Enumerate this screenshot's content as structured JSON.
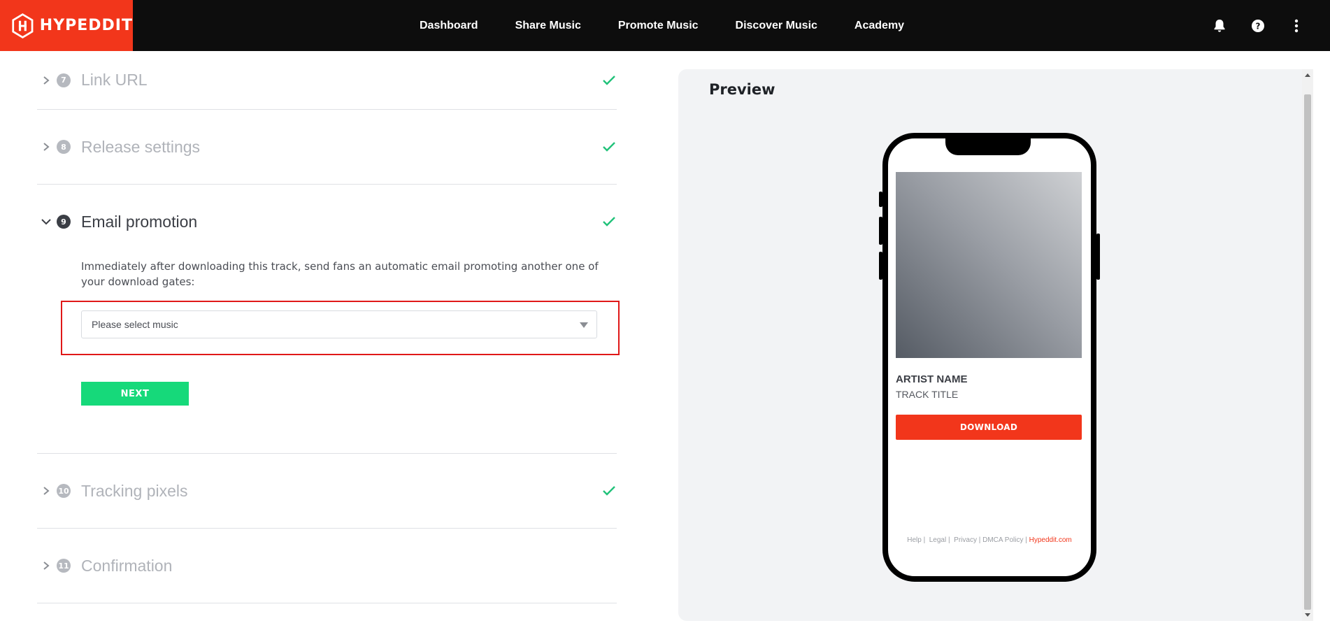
{
  "brand": {
    "name": "HYPEDDIT",
    "color": "#f2361b"
  },
  "nav": {
    "items": [
      {
        "label": "Dashboard"
      },
      {
        "label": "Share Music"
      },
      {
        "label": "Promote Music"
      },
      {
        "label": "Discover Music"
      },
      {
        "label": "Academy"
      }
    ]
  },
  "top_icons": [
    "bell-icon",
    "help-icon",
    "more-vertical-icon"
  ],
  "steps": [
    {
      "number": "7",
      "title": "Link URL",
      "state": "complete"
    },
    {
      "number": "8",
      "title": "Release settings",
      "state": "complete"
    },
    {
      "number": "9",
      "title": "Email promotion",
      "state": "active",
      "description": "Immediately after downloading this track, send fans an automatic email promoting another one of your download gates:",
      "select_value": "Please select music",
      "next_label": "NEXT"
    },
    {
      "number": "10",
      "title": "Tracking pixels",
      "state": "complete"
    },
    {
      "number": "11",
      "title": "Confirmation",
      "state": "incomplete"
    }
  ],
  "preview": {
    "title": "Preview",
    "artist_name": "ARTIST NAME",
    "track_title": "TRACK TITLE",
    "download_label": "DOWNLOAD",
    "footer": {
      "help": "Help",
      "legal": "Legal",
      "privacy": "Privacy",
      "dmca": "DMCA Policy",
      "site": "Hypeddit.com"
    }
  },
  "colors": {
    "accent": "#f2361b",
    "success": "#16d97a",
    "check": "#21c27a",
    "highlight": "#e01818"
  }
}
